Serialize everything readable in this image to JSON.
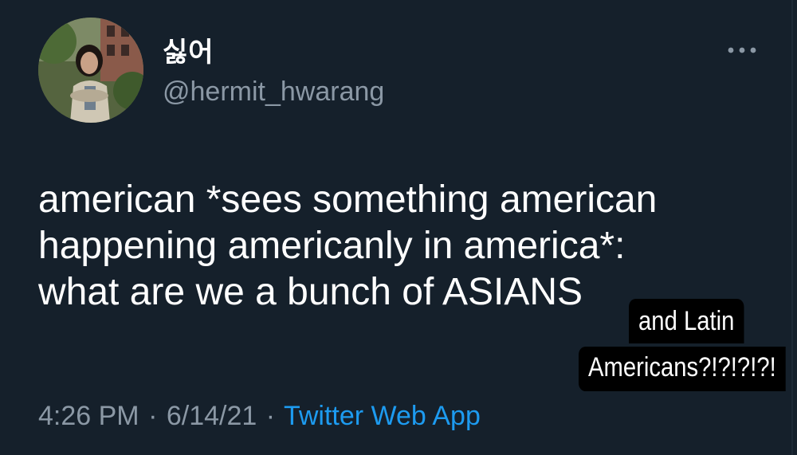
{
  "tweet": {
    "display_name": "싫어",
    "handle": "@hermit_hwarang",
    "text_lines": [
      "american *sees something american",
      "happening americanly in america*:",
      "what are we a bunch of ASIANS"
    ],
    "time": "4:26 PM",
    "separator": "·",
    "date": "6/14/21",
    "source": "Twitter Web App",
    "more_icon": "more-horizontal-icon",
    "avatar_icon": "profile-avatar"
  },
  "overlay": {
    "line1": "and Latin",
    "line2": "Americans?!?!?!?!"
  },
  "colors": {
    "background": "#15202b",
    "primary_text": "#ffffff",
    "secondary_text": "#8b98a5",
    "link": "#1d9bf0",
    "overlay_background": "#000000"
  }
}
